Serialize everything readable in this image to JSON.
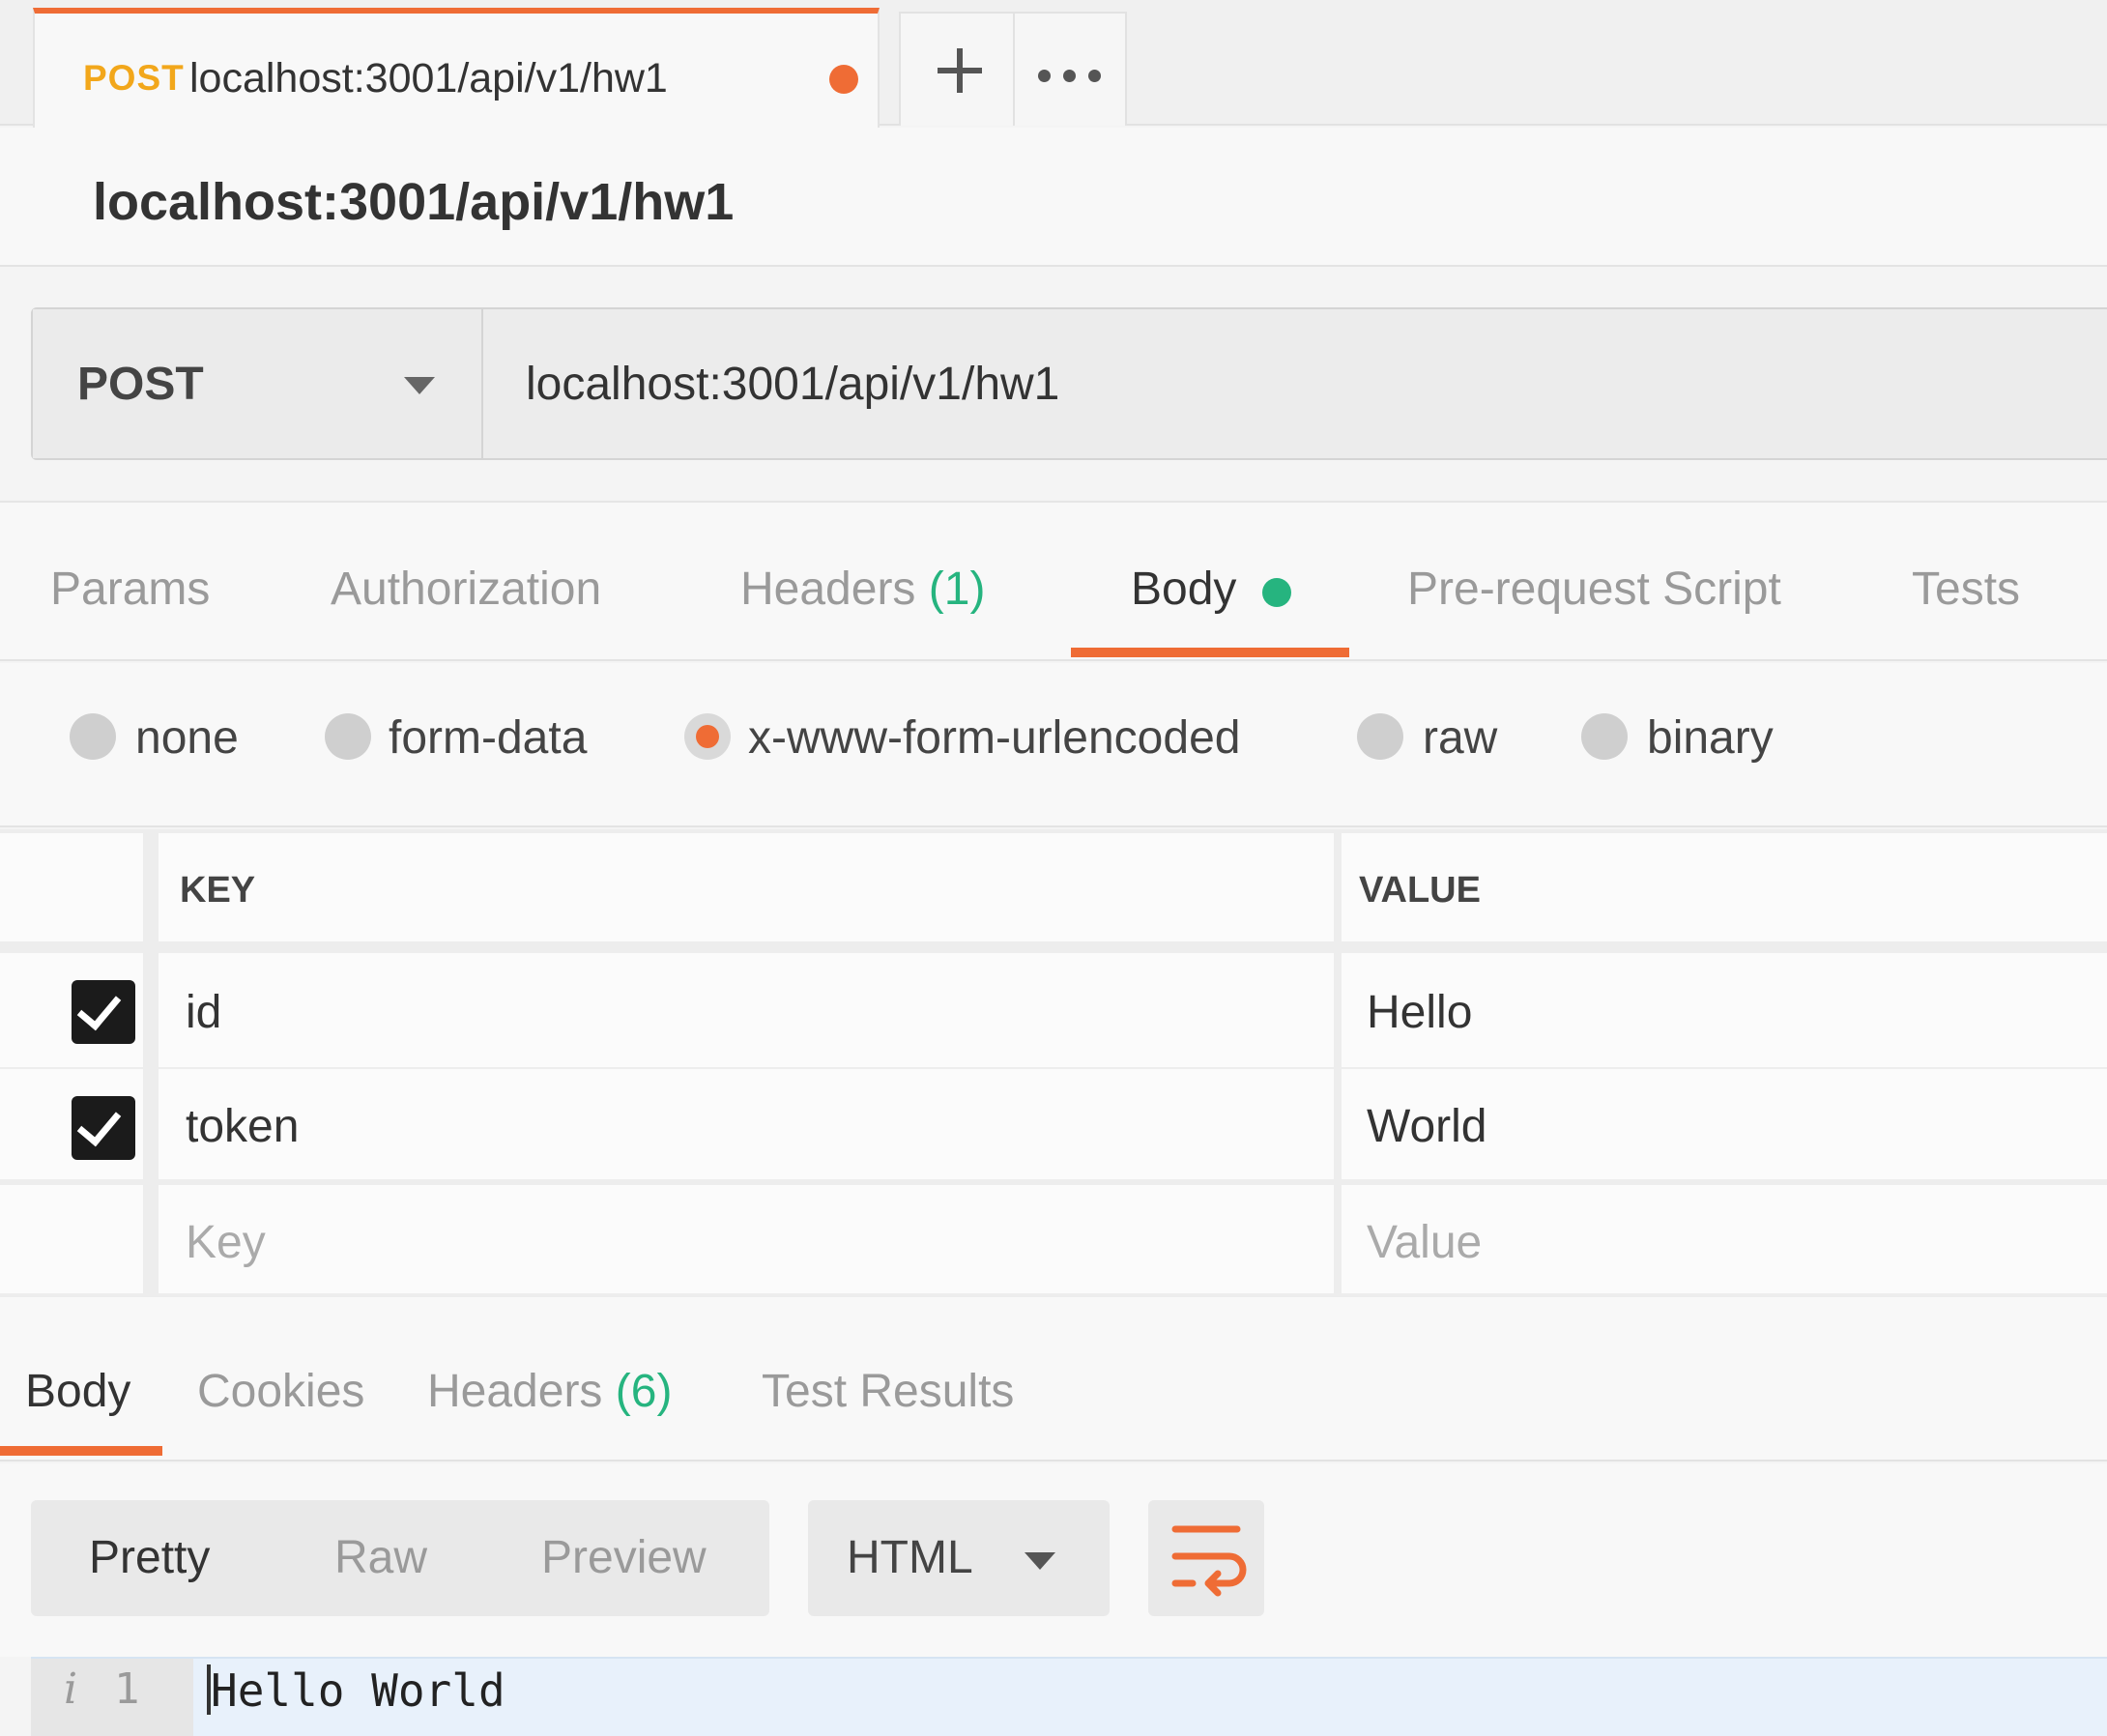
{
  "request_tab": {
    "method": "POST",
    "name": "localhost:3001/api/v1/hw1",
    "unsaved": true
  },
  "page_title": "localhost:3001/api/v1/hw1",
  "url_bar": {
    "method": "POST",
    "url": "localhost:3001/api/v1/hw1"
  },
  "request_tabs": [
    {
      "label": "Params"
    },
    {
      "label": "Authorization"
    },
    {
      "label": "Headers",
      "count": "(1)"
    },
    {
      "label": "Body",
      "active": true
    },
    {
      "label": "Pre-request Script"
    },
    {
      "label": "Tests"
    }
  ],
  "body_types": [
    {
      "label": "none"
    },
    {
      "label": "form-data"
    },
    {
      "label": "x-www-form-urlencoded",
      "selected": true
    },
    {
      "label": "raw"
    },
    {
      "label": "binary"
    }
  ],
  "params_table": {
    "headers": {
      "key": "KEY",
      "value": "VALUE"
    },
    "rows": [
      {
        "checked": true,
        "key": "id",
        "value": "Hello"
      },
      {
        "checked": true,
        "key": "token",
        "value": "World"
      }
    ],
    "placeholder": {
      "key": "Key",
      "value": "Value"
    }
  },
  "response_tabs": [
    {
      "label": "Body",
      "active": true
    },
    {
      "label": "Cookies"
    },
    {
      "label": "Headers",
      "count": "(6)"
    },
    {
      "label": "Test Results"
    }
  ],
  "response_toolbar": {
    "formats": [
      "Pretty",
      "Raw",
      "Preview"
    ],
    "active_format": "Pretty",
    "language": "HTML",
    "wrap_icon": "wrap-lines-icon"
  },
  "response_body": {
    "line_number": "1",
    "info_icon": "i",
    "line": "Hello World"
  },
  "colors": {
    "accent": "#ef6c35",
    "method_post": "#f2a71b",
    "count_green": "#26b47f"
  }
}
